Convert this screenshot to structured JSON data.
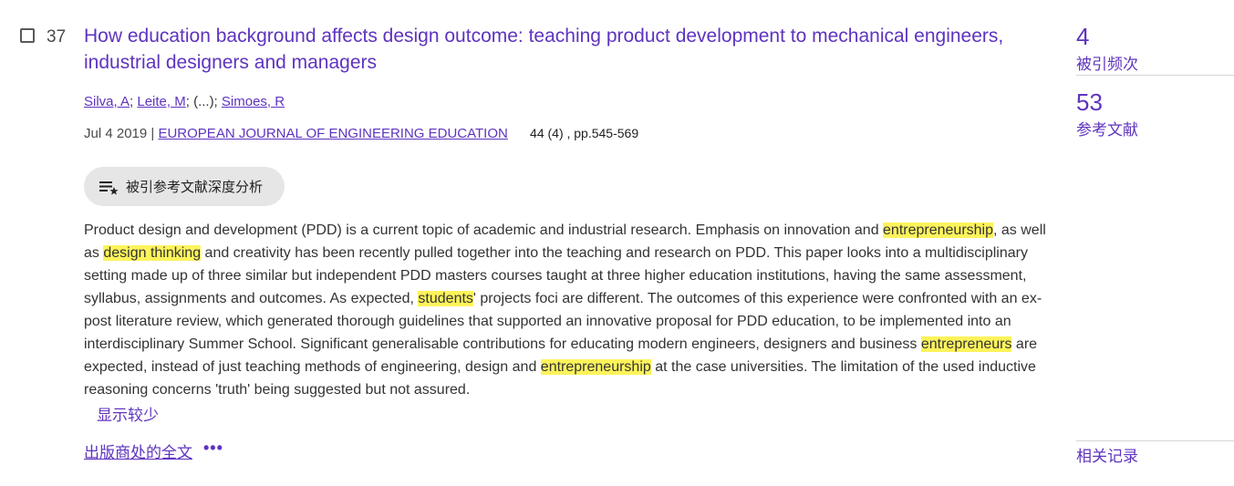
{
  "record": {
    "number": "37",
    "title": "How education background affects design outcome: teaching product development to mechanical engineers, industrial designers and managers",
    "authors": [
      "Silva, A",
      "Leite, M",
      "Simoes, R"
    ],
    "authors_sep1": "; ",
    "authors_ellipsis": "; (...); ",
    "date": "Jul 4 2019",
    "date_sep": " | ",
    "journal": "EUROPEAN JOURNAL OF ENGINEERING EDUCATION",
    "volume_pages": "44 (4) , pp.545-569",
    "analysis_button_label": "被引参考文献深度分析",
    "abstract_segments": [
      {
        "text": "Product design and development (PDD) is a current topic of academic and industrial research. Emphasis on innovation and "
      },
      {
        "text": "entrepreneurship",
        "highlight": true
      },
      {
        "text": ", as well as "
      },
      {
        "text": "design thinking",
        "highlight": true
      },
      {
        "text": " and creativity has been recently pulled together into the teaching and research on PDD. This paper looks into a multidisciplinary setting made up of three similar but independent PDD masters courses taught at three higher education institutions, having the same assessment, syllabus, assignments and outcomes. As expected, "
      },
      {
        "text": "students",
        "highlight": true
      },
      {
        "text": "' projects foci are different. The outcomes of this experience were confronted with an ex-post literature review, which generated thorough guidelines that supported an innovative proposal for PDD education, to be implemented into an interdisciplinary Summer School. Significant generalisable contributions for educating modern engineers, designers and business "
      },
      {
        "text": "entrepreneurs",
        "highlight": true
      },
      {
        "text": " are expected, instead of just teaching methods of engineering, design and "
      },
      {
        "text": "entrepreneurship",
        "highlight": true
      },
      {
        "text": " at the case universities. The limitation of the used inductive reasoning concerns 'truth' being suggested but not assured."
      }
    ],
    "show_less_label": "显示较少",
    "full_text_label": "出版商处的全文",
    "more_icon": "more-dots-icon"
  },
  "metrics": {
    "citations_count": "4",
    "citations_label": "被引频次",
    "references_count": "53",
    "references_label": "参考文献",
    "related_label": "相关记录"
  },
  "colors": {
    "accent": "#5e33bf",
    "highlight": "#fdf35b",
    "button_bg": "#e6e6e6"
  }
}
